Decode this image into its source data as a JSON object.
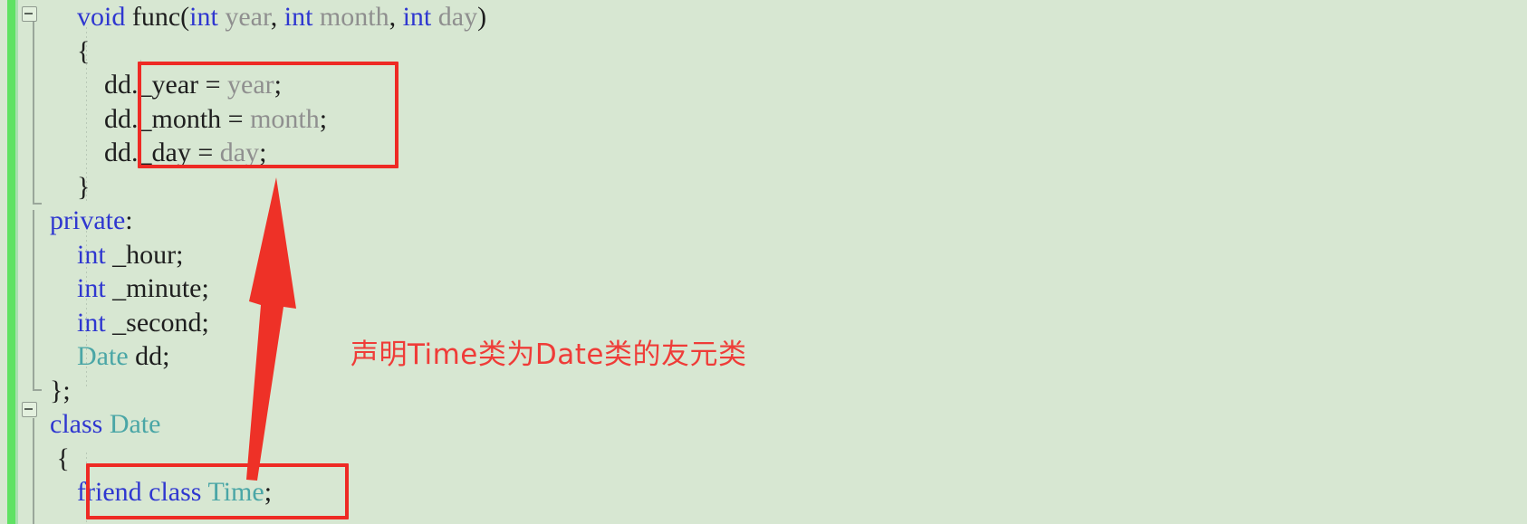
{
  "editor": {
    "background_color": "#d7e7d2",
    "change_bar_color": "#5fe263",
    "annotation_color": "#ee2a24",
    "keyword_color": "#2f37d0",
    "type_color": "#4aa6a6",
    "param_color": "#8f8f8f",
    "text_color": "#1c1c1c"
  },
  "code_lines": [
    {
      "id": "line-func-signature",
      "tokens": [
        {
          "t": "    ",
          "c": "pl"
        },
        {
          "t": "void",
          "c": "kw"
        },
        {
          "t": " ",
          "c": "pl"
        },
        {
          "t": "func",
          "c": "pl"
        },
        {
          "t": "(",
          "c": "pn"
        },
        {
          "t": "int",
          "c": "kw"
        },
        {
          "t": " ",
          "c": "pl"
        },
        {
          "t": "year",
          "c": "id"
        },
        {
          "t": ", ",
          "c": "pn"
        },
        {
          "t": "int",
          "c": "kw"
        },
        {
          "t": " ",
          "c": "pl"
        },
        {
          "t": "month",
          "c": "id"
        },
        {
          "t": ", ",
          "c": "pn"
        },
        {
          "t": "int",
          "c": "kw"
        },
        {
          "t": " ",
          "c": "pl"
        },
        {
          "t": "day",
          "c": "id"
        },
        {
          "t": ")",
          "c": "pn"
        }
      ]
    },
    {
      "id": "line-open-brace-func",
      "tokens": [
        {
          "t": "    {",
          "c": "pn"
        }
      ]
    },
    {
      "id": "line-assign-year",
      "tokens": [
        {
          "t": "        dd._year = ",
          "c": "pl"
        },
        {
          "t": "year",
          "c": "id"
        },
        {
          "t": ";",
          "c": "pn"
        }
      ]
    },
    {
      "id": "line-assign-month",
      "tokens": [
        {
          "t": "        dd._month = ",
          "c": "pl"
        },
        {
          "t": "month",
          "c": "id"
        },
        {
          "t": ";",
          "c": "pn"
        }
      ]
    },
    {
      "id": "line-assign-day",
      "tokens": [
        {
          "t": "        dd._day = ",
          "c": "pl"
        },
        {
          "t": "day",
          "c": "id"
        },
        {
          "t": ";",
          "c": "pn"
        }
      ]
    },
    {
      "id": "line-close-brace-func",
      "tokens": [
        {
          "t": "    }",
          "c": "pn"
        }
      ]
    },
    {
      "id": "line-private",
      "tokens": [
        {
          "t": "private",
          "c": "kw"
        },
        {
          "t": ":",
          "c": "pn"
        }
      ]
    },
    {
      "id": "line-member-hour",
      "tokens": [
        {
          "t": "    ",
          "c": "pl"
        },
        {
          "t": "int",
          "c": "kw"
        },
        {
          "t": " _hour;",
          "c": "pl"
        }
      ]
    },
    {
      "id": "line-member-minute",
      "tokens": [
        {
          "t": "    ",
          "c": "pl"
        },
        {
          "t": "int",
          "c": "kw"
        },
        {
          "t": " _minute;",
          "c": "pl"
        }
      ]
    },
    {
      "id": "line-member-second",
      "tokens": [
        {
          "t": "    ",
          "c": "pl"
        },
        {
          "t": "int",
          "c": "kw"
        },
        {
          "t": " _second;",
          "c": "pl"
        }
      ]
    },
    {
      "id": "line-member-dd",
      "tokens": [
        {
          "t": "    ",
          "c": "pl"
        },
        {
          "t": "Date",
          "c": "ty"
        },
        {
          "t": " dd;",
          "c": "pl"
        }
      ]
    },
    {
      "id": "line-close-class-time",
      "tokens": [
        {
          "t": "};",
          "c": "pn"
        }
      ]
    },
    {
      "id": "line-class-date",
      "tokens": [
        {
          "t": "class",
          "c": "kw"
        },
        {
          "t": " ",
          "c": "pl"
        },
        {
          "t": "Date",
          "c": "ty"
        }
      ]
    },
    {
      "id": "line-open-brace-date",
      "tokens": [
        {
          "t": " {",
          "c": "pn"
        }
      ]
    },
    {
      "id": "line-friend-decl",
      "tokens": [
        {
          "t": "    ",
          "c": "pl"
        },
        {
          "t": "friend",
          "c": "kw"
        },
        {
          "t": " ",
          "c": "pl"
        },
        {
          "t": "class",
          "c": "kw"
        },
        {
          "t": " ",
          "c": "pl"
        },
        {
          "t": "Time",
          "c": "ty"
        },
        {
          "t": ";",
          "c": "pn"
        }
      ]
    }
  ],
  "annotations": {
    "note_text": "声明Time类为Date类的友元类",
    "highlight_box_assignments": "dd._year / dd._month / dd._day assignment block",
    "highlight_box_friend": "friend class Time;"
  }
}
